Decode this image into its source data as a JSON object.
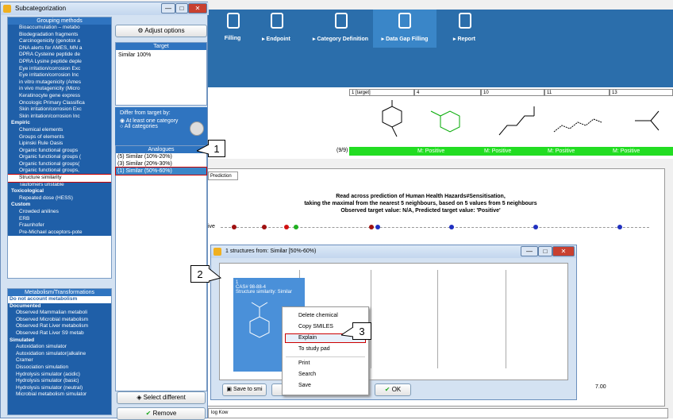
{
  "subwindow": {
    "title": "Subcategorization",
    "minimize": "—",
    "maximize": "□",
    "close": "✕"
  },
  "toolbar": {
    "items": [
      {
        "label": "Filling"
      },
      {
        "label": "▸ Endpoint"
      },
      {
        "label": "▸ Category Definition"
      },
      {
        "label": "▸ Data Gap Filling"
      },
      {
        "label": "▸ Report"
      }
    ]
  },
  "grid": {
    "headers": [
      "1 [target]",
      "4",
      "10",
      "11",
      "13"
    ],
    "count": "(9/9)",
    "results": [
      "M: Positive",
      "M: Positive",
      "M: Positive",
      "M: Positive"
    ]
  },
  "prediction": {
    "tab": "Prediction",
    "line1": "Read across prediction of Human Health Hazards#Sensitisation,",
    "line2": "taking the maximal from the nearest 5 neighbours, based on 5 values from 5 neighbours",
    "line3": "Observed target value: N/A, Predicted target value: 'Positive'",
    "ylabel": "ive",
    "xtick": "7.00"
  },
  "tree": {
    "header": "Grouping methods",
    "items": [
      "Bioaccumulation – metabo",
      "Biodegradation fragments",
      "Carcinogenicity (genotox a",
      "DNA alerts for AMES, MN a",
      "DPRA Cysteine peptide de",
      "DPRA Lysine peptide deple",
      "Eye irritation/corrosion Exc",
      "Eye irritation/corrosion Inc",
      "in vitro mutagenicity (Ames",
      "in vivo mutagenicity (Micro",
      "Keratinocyte gene express",
      "Oncologic Primary Classifica",
      "Skin irritation/corrosion Exc",
      "Skin irritation/corrosion Inc",
      "Empiric",
      "Chemical elements",
      "Groups of elements",
      "Lipinski Rule Oasis",
      "Organic functional groups",
      "Organic functional groups (",
      "Organic functional groups(",
      "Organic functional groups,",
      "Structure similarity",
      "Tautomers unstable",
      "Toxicological",
      "Repeated dose (HESS)",
      "Custom",
      "Crowded anilines",
      "ERB",
      "Fraunhofer",
      "Pre-Michael acceptors-pote"
    ],
    "selected_index": 22
  },
  "metabolism": {
    "header": "Metabolism/Transformations",
    "items": [
      "Do not account metabolism",
      "Documented",
      "Observed Mammalian metaboli",
      "Observed Microbial metabolism",
      "Observed Rat Liver metabolism",
      "Observed Rat Liver S9 metab",
      "Simulated",
      "Autoxidation simulator",
      "Autoxidation simulator(alkaline",
      "Cramer",
      "Dissociation simulation",
      "Hydrolysis simulator (acidic)",
      "Hydrolysis simulator (basic)",
      "Hydrolysis simulator (neutral)",
      "Microbial metabolism simulator"
    ]
  },
  "middle": {
    "adjust_options": "Adjust options",
    "target_header": "Target",
    "target_value": "Similar 100%",
    "differ_label": "Differ from target by:",
    "radio_one": "At least one category",
    "radio_all": "All categories",
    "analogues_header": "Analogues",
    "analogues": [
      "(5) Similar (10%-20%)",
      "(3) Similar (20%-30%)",
      "(1) Similar (50%-60%)"
    ],
    "select_different": "Select different",
    "remove": "Remove"
  },
  "dialog": {
    "title": "1 structures from: Similar [50%-60%)",
    "card_index": "1",
    "card_cas": "CAS# 98-88-4",
    "card_sim": "Structure similarity: Similar",
    "save_to_smi": "Save to smi",
    "ok": "OK"
  },
  "context_menu": {
    "items": [
      "Delete chemical",
      "Copy SMILES",
      "Explain",
      "To study pad",
      "Print",
      "Search",
      "Save"
    ]
  },
  "callouts": [
    "1",
    "2",
    "3"
  ],
  "bottom": {
    "combo": "log Kow"
  }
}
